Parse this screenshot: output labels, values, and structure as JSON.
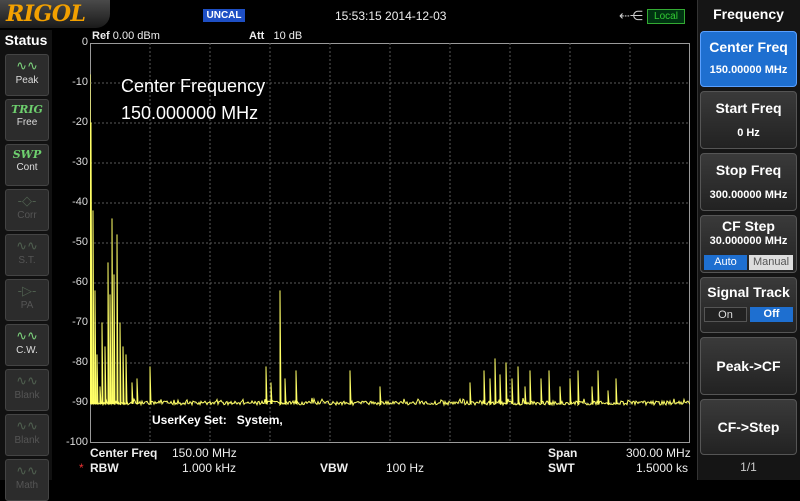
{
  "header": {
    "logo": "RIGOL",
    "uncal_badge": "UNCAL",
    "datetime": "15:53:15 2014-12-03",
    "usb_icon": "usb-icon",
    "local_badge": "Local"
  },
  "status": {
    "title": "Status",
    "buttons": [
      {
        "icon": "peak-icon",
        "glyph": "∿∿",
        "label": "Peak",
        "active": true
      },
      {
        "icon": "trig-icon",
        "glyph": "TRIG",
        "label": "Free",
        "active": true
      },
      {
        "icon": "swp-icon",
        "glyph": "SWP",
        "label": "Cont",
        "active": true
      },
      {
        "icon": "corr-icon",
        "glyph": "-◇-",
        "label": "Corr",
        "active": false
      },
      {
        "icon": "st-icon",
        "glyph": "∿∿",
        "label": "S.T.",
        "active": false
      },
      {
        "icon": "pa-icon",
        "glyph": "-▷-",
        "label": "PA",
        "active": false
      },
      {
        "icon": "cw-icon",
        "glyph": "∿∿",
        "label": "C.W.",
        "active": true
      },
      {
        "icon": "blank-icon",
        "glyph": "∿∿",
        "label": "Blank",
        "active": false
      },
      {
        "icon": "blank-icon",
        "glyph": "∿∿",
        "label": "Blank",
        "active": false
      },
      {
        "icon": "math-icon",
        "glyph": "∿∿",
        "label": "Math",
        "active": false
      }
    ]
  },
  "graph": {
    "ref_label": "Ref",
    "ref_value": "0.00 dBm",
    "att_label": "Att",
    "att_value": "10 dB",
    "annotation_line1": "Center Frequency",
    "annotation_line2": "150.000000 MHz",
    "userkey_label": "UserKey Set:",
    "userkey_value": "System,",
    "trace_color": "#ffff66",
    "grid_color": "#5a5a5a"
  },
  "chart_data": {
    "type": "line",
    "xlabel": "",
    "ylabel": "",
    "ylim": [
      -100,
      0
    ],
    "xlim": [
      0,
      300
    ],
    "yticks": [
      "0",
      "-10",
      "-20",
      "-30",
      "-40",
      "-50",
      "-60",
      "-70",
      "-80",
      "-90",
      "-100"
    ],
    "grid": true,
    "noise_floor": -90,
    "peaks": [
      {
        "x": 0.0,
        "y": -8
      },
      {
        "x": 0.5,
        "y": -20
      },
      {
        "x": 1.5,
        "y": -42
      },
      {
        "x": 2.5,
        "y": -62
      },
      {
        "x": 3.5,
        "y": -78
      },
      {
        "x": 5.0,
        "y": -86
      },
      {
        "x": 6.0,
        "y": -70
      },
      {
        "x": 7.5,
        "y": -76
      },
      {
        "x": 9.0,
        "y": -55
      },
      {
        "x": 10.0,
        "y": -63
      },
      {
        "x": 11.0,
        "y": -44
      },
      {
        "x": 12.0,
        "y": -58
      },
      {
        "x": 13.5,
        "y": -48
      },
      {
        "x": 15.0,
        "y": -70
      },
      {
        "x": 16.5,
        "y": -76
      },
      {
        "x": 18.0,
        "y": -78
      },
      {
        "x": 21.0,
        "y": -85
      },
      {
        "x": 23.5,
        "y": -84
      },
      {
        "x": 30.0,
        "y": -81
      },
      {
        "x": 88.0,
        "y": -81
      },
      {
        "x": 90.5,
        "y": -85
      },
      {
        "x": 95.0,
        "y": -62
      },
      {
        "x": 97.5,
        "y": -84
      },
      {
        "x": 103.0,
        "y": -82
      },
      {
        "x": 130.0,
        "y": -82
      },
      {
        "x": 145.0,
        "y": -86
      },
      {
        "x": 190.0,
        "y": -85
      },
      {
        "x": 197.0,
        "y": -82
      },
      {
        "x": 200.0,
        "y": -84
      },
      {
        "x": 202.5,
        "y": -79
      },
      {
        "x": 205.0,
        "y": -83
      },
      {
        "x": 208.0,
        "y": -80
      },
      {
        "x": 211.0,
        "y": -84
      },
      {
        "x": 214.0,
        "y": -81
      },
      {
        "x": 217.5,
        "y": -86
      },
      {
        "x": 220.0,
        "y": -82
      },
      {
        "x": 225.5,
        "y": -84
      },
      {
        "x": 229.5,
        "y": -82
      },
      {
        "x": 235.0,
        "y": -86
      },
      {
        "x": 240.0,
        "y": -84
      },
      {
        "x": 244.0,
        "y": -82
      },
      {
        "x": 251.0,
        "y": -86
      },
      {
        "x": 254.0,
        "y": -82
      },
      {
        "x": 259.0,
        "y": -87
      },
      {
        "x": 263.0,
        "y": -84
      }
    ]
  },
  "readouts": {
    "center_freq_label": "Center Freq",
    "center_freq_value": "150.00 MHz",
    "span_label": "Span",
    "span_value": "300.00 MHz",
    "rbw_marker": "*",
    "rbw_label": "RBW",
    "rbw_value": "1.000 kHz",
    "vbw_label": "VBW",
    "vbw_value": "100 Hz",
    "swt_label": "SWT",
    "swt_value": "1.5000 ks"
  },
  "menu": {
    "title": "Frequency",
    "center_freq": {
      "title": "Center Freq",
      "value": "150.00000 MHz"
    },
    "start_freq": {
      "title": "Start Freq",
      "value": "0 Hz"
    },
    "stop_freq": {
      "title": "Stop Freq",
      "value": "300.00000 MHz"
    },
    "cf_step": {
      "title": "CF Step",
      "value": "30.000000 MHz",
      "opt_a": "Auto",
      "opt_b": "Manual"
    },
    "signal_track": {
      "title": "Signal Track",
      "opt_a": "On",
      "opt_b": "Off"
    },
    "peak_cf": "Peak->CF",
    "cf_step_btn": "CF->Step",
    "page": "1/1"
  },
  "colors": {
    "accent": "#1e6fd0",
    "logo": "#f2a000",
    "local": "#33cc33"
  }
}
